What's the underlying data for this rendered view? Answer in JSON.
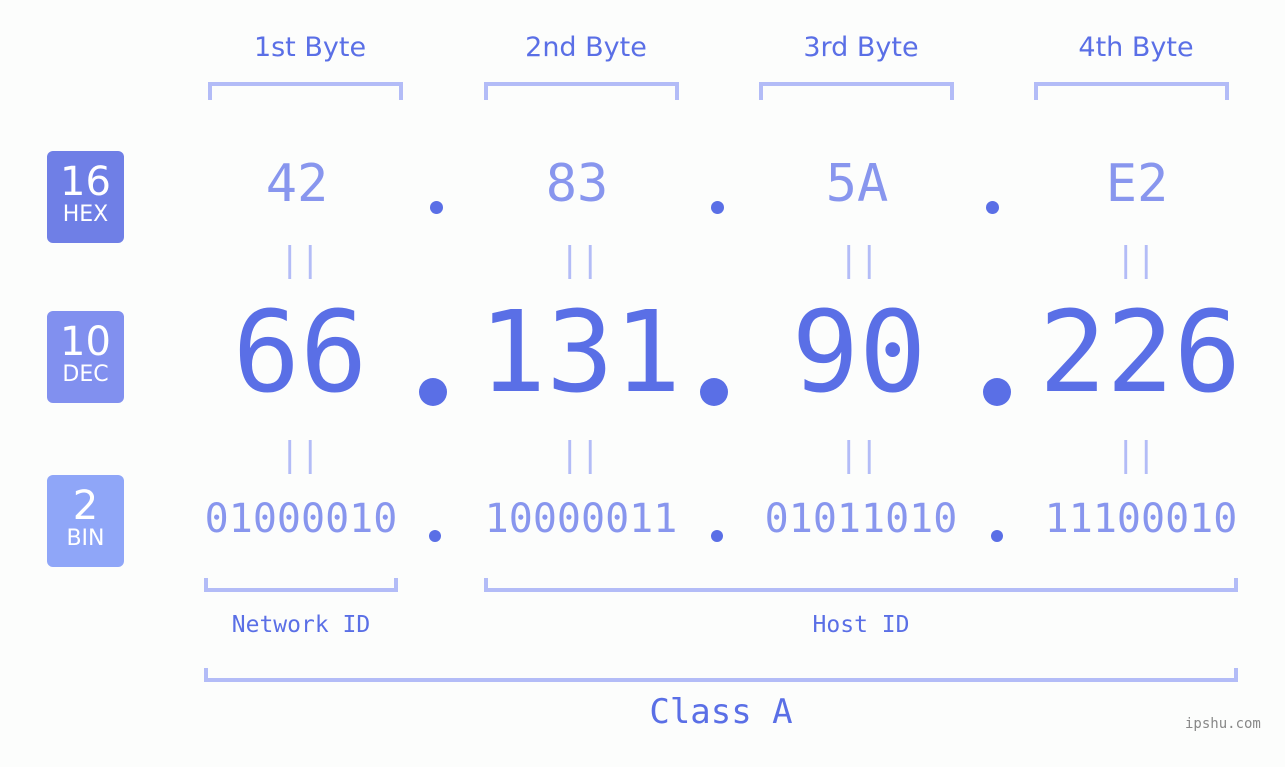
{
  "byte_headers": [
    "1st Byte",
    "2nd Byte",
    "3rd Byte",
    "4th Byte"
  ],
  "badges": [
    {
      "base": "16",
      "label": "HEX",
      "color": "#6f7fe6"
    },
    {
      "base": "10",
      "label": "DEC",
      "color": "#8190ef"
    },
    {
      "base": "2",
      "label": "BIN",
      "color": "#8fa6f8"
    }
  ],
  "hex": [
    "42",
    "83",
    "5A",
    "E2"
  ],
  "dec": [
    "66",
    "131",
    "90",
    "226"
  ],
  "bin": [
    "01000010",
    "10000011",
    "01011010",
    "11100010"
  ],
  "equals_symbol": "||",
  "network_id_label": "Network ID",
  "host_id_label": "Host ID",
  "class_label": "Class A",
  "watermark": "ipshu.com",
  "colors": {
    "primary": "#5a6fe6",
    "secondary": "#8896ee",
    "bracket": "#b3bcf7",
    "background": "#fcfdfc"
  }
}
